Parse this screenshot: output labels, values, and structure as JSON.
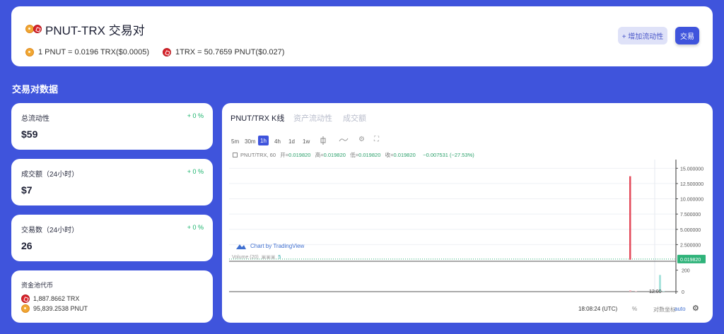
{
  "header": {
    "pair_title": "PNUT-TRX 交易对",
    "rate_pnut": "1 PNUT = 0.0196 TRX($0.0005)",
    "rate_trx": "1TRX = 50.7659 PNUT($0.027)",
    "add_liquidity_label": "+ 增加流动性",
    "trade_label": "交易"
  },
  "section_title": "交易对数据",
  "stats": {
    "liquidity": {
      "label": "总流动性",
      "change": "+ 0 %",
      "value": "$59"
    },
    "volume": {
      "label": "成交额（24小时）",
      "change": "+ 0 %",
      "value": "$7"
    },
    "tx_count": {
      "label": "交易数（24小时）",
      "change": "+ 0 %",
      "value": "26"
    }
  },
  "pool": {
    "label": "资金池代币",
    "trx_amount": "1,887.8662 TRX",
    "pnut_amount": "95,839.2538 PNUT"
  },
  "chart_panel": {
    "tabs": [
      "PNUT/TRX K线",
      "资产流动性",
      "成交额"
    ],
    "timeframes": [
      "5m",
      "30m",
      "1h",
      "4h",
      "1d",
      "1w"
    ],
    "selected_timeframe": "1h",
    "ohlc": {
      "symbol": "PNUT/TRX, 60",
      "open_label": "开",
      "open": "0.019820",
      "high_label": "高",
      "high": "0.019820",
      "low_label": "低",
      "low": "0.019820",
      "close_label": "收",
      "close": "0.019820",
      "change": "−0.007531 (−27.53%)"
    },
    "watermark": "Chart by TradingView",
    "volume_label": "Volume (20)",
    "volume_value": "5",
    "footer": {
      "time": "18:08:24 (UTC)",
      "percent": "%",
      "log": "对数坐标",
      "auto": "auto"
    }
  },
  "chart_data": {
    "type": "bar",
    "title": "PNUT/TRX K线",
    "price_axis_ticks": [
      "15.000000",
      "12.500000",
      "10.000000",
      "7.500000",
      "5.000000",
      "2.500000"
    ],
    "price_ylim": [
      0,
      15.5
    ],
    "last_price": 0.01982,
    "last_price_label": "0.019820",
    "spike_candle": {
      "high": 13.7,
      "low": 0.01982,
      "color": "#e34a5a"
    },
    "volume_ticks": [
      "200",
      "0"
    ],
    "volume_bars": [
      {
        "value": 12,
        "color": "#f2b3ba"
      },
      {
        "value": 4,
        "color": "#f2b3ba"
      },
      {
        "value": 155,
        "color": "#a8e3dc"
      },
      {
        "value": 5,
        "color": "#a8e3dc"
      }
    ],
    "volume_ylim": [
      0,
      230
    ],
    "x_tick": "12:00",
    "colors": {
      "up": "#26a69a",
      "down": "#e34a5a",
      "last_price": "#2fb37a"
    }
  }
}
